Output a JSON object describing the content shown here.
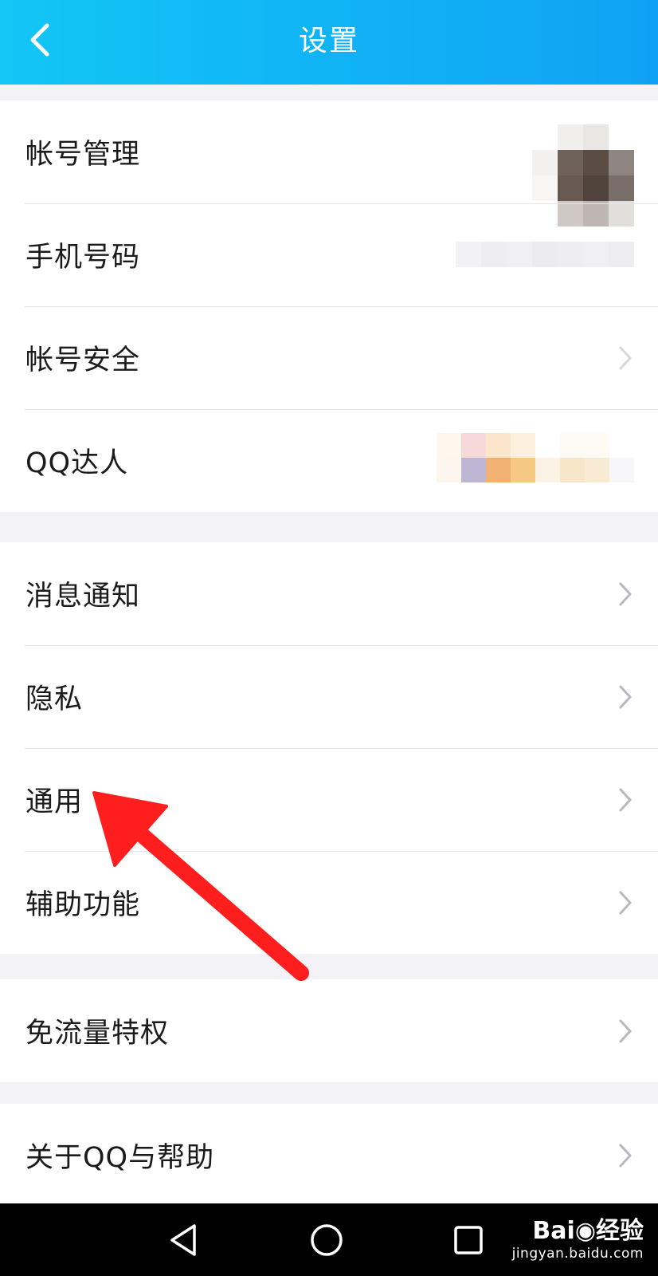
{
  "header": {
    "title": "设置"
  },
  "group1": {
    "items": [
      {
        "label": "帐号管理"
      },
      {
        "label": "手机号码"
      },
      {
        "label": "帐号安全"
      },
      {
        "label": "QQ达人"
      }
    ]
  },
  "group2": {
    "items": [
      {
        "label": "消息通知"
      },
      {
        "label": "隐私"
      },
      {
        "label": "通用"
      },
      {
        "label": "辅助功能"
      }
    ]
  },
  "group3": {
    "items": [
      {
        "label": "免流量特权"
      }
    ]
  },
  "group4": {
    "items": [
      {
        "label": "关于QQ与帮助"
      }
    ]
  },
  "watermark": {
    "logo": "Bai◉经验",
    "url": "jingyan.baidu.com"
  },
  "colors": {
    "header_accent": "#10b2f5",
    "annotation_arrow": "#ff1e1e"
  }
}
